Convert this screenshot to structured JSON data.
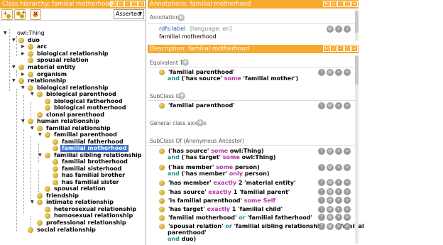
{
  "hierarchy": {
    "title": "Class hierarchy: familial motherhood",
    "dropdown": "Asserted",
    "nodes": [
      {
        "label": "owl:Thing",
        "toggle": "▼"
      },
      {
        "label": "duo",
        "toggle": "▼"
      },
      {
        "label": "arc",
        "toggle": "▶"
      },
      {
        "label": "biological relationship",
        "toggle": "▶"
      },
      {
        "label": "spousal relation",
        "toggle": ""
      },
      {
        "label": "material entity",
        "toggle": "▼"
      },
      {
        "label": "organism",
        "toggle": "▶"
      },
      {
        "label": "relationship",
        "toggle": "▼"
      },
      {
        "label": "biological relationship",
        "toggle": "▼"
      },
      {
        "label": "biological parenthood",
        "toggle": "▼"
      },
      {
        "label": "biological fatherhood",
        "toggle": ""
      },
      {
        "label": "biological motherhood",
        "toggle": ""
      },
      {
        "label": "clonal parenthood",
        "toggle": ""
      },
      {
        "label": "human relationship",
        "toggle": "▼"
      },
      {
        "label": "familial relationship",
        "toggle": "▼"
      },
      {
        "label": "familial parenthood",
        "toggle": "▼"
      },
      {
        "label": "familial fatherhood",
        "toggle": ""
      },
      {
        "label": "familial motherhood",
        "toggle": ""
      },
      {
        "label": "familial sibling relationship",
        "toggle": "▼"
      },
      {
        "label": "familial brotherhood",
        "toggle": ""
      },
      {
        "label": "familial sisterhood",
        "toggle": ""
      },
      {
        "label": "has familial brother",
        "toggle": ""
      },
      {
        "label": "has familial sister",
        "toggle": ""
      },
      {
        "label": "spousal relation",
        "toggle": ""
      },
      {
        "label": "friendship",
        "toggle": ""
      },
      {
        "label": "intimate relationship",
        "toggle": "▼"
      },
      {
        "label": "heterosexual relationship",
        "toggle": ""
      },
      {
        "label": "homosexual relationship",
        "toggle": ""
      },
      {
        "label": "professional relationship",
        "toggle": ""
      },
      {
        "label": "social relationship",
        "toggle": ""
      }
    ]
  },
  "annotations": {
    "title": "Annotations: familial motherhood",
    "section": "Annotations",
    "property": "rdfs:label",
    "lang": "[language: en]",
    "value": "familial motherhood"
  },
  "description": {
    "title": "Description: familial motherhood",
    "equivalent_to": "Equivalent To",
    "eq_line1": "'familial parenthood'",
    "eq_and": "and",
    "eq_line2a": "('has source'",
    "eq_some": "some",
    "eq_line2b": "'familial mother')",
    "subclass_of": "SubClass Of",
    "sub1": "'familial parenthood'",
    "general_axioms": "General class axioms",
    "subclass_anon": "SubClass Of (Anonymous Ancestor)",
    "a1a": "('has source'",
    "a1kw": "some",
    "a1b": "owl:Thing)",
    "a1c_and": "and",
    "a1c": "('has target'",
    "a1ckw": "some",
    "a1d": "owl:Thing)",
    "a2a": "('has member'",
    "a2kw": "some",
    "a2b": "person)",
    "a2c_and": "and",
    "a2c": "('has member'",
    "a2ckw": "only",
    "a2d": "person)",
    "a3a": "'has member'",
    "a3kw": "exactly",
    "a3b": "2 'material entity'",
    "a4a": "'has source'",
    "a4kw": "exactly",
    "a4b": "1 'familial parent'",
    "a5a": "'is familial parenthood'",
    "a5kw": "some",
    "a5b": "Self",
    "a6a": "'has target'",
    "a6kw": "exactly",
    "a6b": "1 'familial child'",
    "a7a": "'familial motherhood'",
    "a7kw": "or",
    "a7b": "'familial fatherhood'",
    "a8a": "'spousal relation'",
    "a8kw": "or",
    "a8b": "'familial sibling relationship'",
    "a8kw2": "or",
    "a8c": "('familial",
    "a8d": "parenthood'",
    "a8e_and": "and",
    "a8f": "duo)"
  },
  "colors": {
    "title_bar": "#f7a92d",
    "selection": "#3a6fcf",
    "keyword_teal": "#1d8f9e",
    "keyword_magenta": "#b22fa5"
  }
}
